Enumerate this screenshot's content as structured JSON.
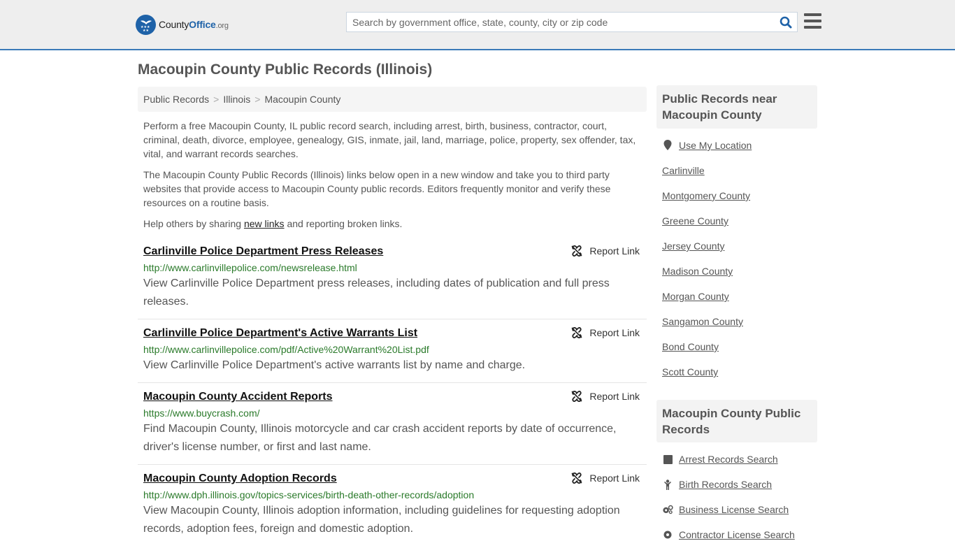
{
  "header": {
    "logo": {
      "name_part1": "County",
      "name_part2": "Office",
      "name_part3": ".org"
    },
    "search": {
      "placeholder": "Search by government office, state, county, city or zip code",
      "value": ""
    },
    "icons": {
      "search": "search-icon",
      "menu": "hamburger-menu-icon"
    }
  },
  "page": {
    "title": "Macoupin County Public Records (Illinois)"
  },
  "breadcrumb": [
    {
      "label": "Public Records"
    },
    {
      "label": "Illinois"
    },
    {
      "label": "Macoupin County"
    }
  ],
  "breadcrumb_separator": ">",
  "intro": {
    "p1": "Perform a free Macoupin County, IL public record search, including arrest, birth, business, contractor, court, criminal, death, divorce, employee, genealogy, GIS, inmate, jail, land, marriage, police, property, sex offender, tax, vital, and warrant records searches.",
    "p2": "The Macoupin County Public Records (Illinois) links below open in a new window and take you to third party websites that provide access to Macoupin County public records. Editors frequently monitor and verify these resources on a routine basis.",
    "p3_before": "Help others by sharing ",
    "p3_link": "new links",
    "p3_after": " and reporting broken links."
  },
  "records": [
    {
      "title": "Carlinville Police Department Press Releases",
      "url": "http://www.carlinvillepolice.com/newsrelease.html",
      "description": "View Carlinville Police Department press releases, including dates of publication and full press releases.",
      "report_label": "Report Link"
    },
    {
      "title": "Carlinville Police Department's Active Warrants List",
      "url": "http://www.carlinvillepolice.com/pdf/Active%20Warrant%20List.pdf",
      "description": "View Carlinville Police Department's active warrants list by name and charge.",
      "report_label": "Report Link"
    },
    {
      "title": "Macoupin County Accident Reports",
      "url": "https://www.buycrash.com/",
      "description": "Find Macoupin County, Illinois motorcycle and car crash accident reports by date of occurrence, driver's license number, or first and last name.",
      "report_label": "Report Link"
    },
    {
      "title": "Macoupin County Adoption Records",
      "url": "http://www.dph.illinois.gov/topics-services/birth-death-other-records/adoption",
      "description": "View Macoupin County, Illinois adoption information, including guidelines for requesting adoption records, adoption fees, foreign and domestic adoption.",
      "report_label": "Report Link"
    }
  ],
  "sidebar": {
    "nearby": {
      "heading": "Public Records near Macoupin County",
      "use_location": {
        "label": "Use My Location",
        "icon": "map-marker-icon"
      },
      "items": [
        {
          "label": "Carlinville"
        },
        {
          "label": "Montgomery County"
        },
        {
          "label": "Greene County"
        },
        {
          "label": "Jersey County"
        },
        {
          "label": "Madison County"
        },
        {
          "label": "Morgan County"
        },
        {
          "label": "Sangamon County"
        },
        {
          "label": "Bond County"
        },
        {
          "label": "Scott County"
        }
      ]
    },
    "county_records": {
      "heading": "Macoupin County Public Records",
      "items": [
        {
          "label": "Arrest Records Search",
          "icon": "square-icon"
        },
        {
          "label": "Birth Records Search",
          "icon": "child-icon"
        },
        {
          "label": "Business License Search",
          "icon": "cogs-icon"
        },
        {
          "label": "Contractor License Search",
          "icon": "cog-icon"
        }
      ]
    }
  },
  "colors": {
    "brand_blue": "#1e62a8",
    "header_bg": "#eeeeee",
    "header_border": "#3a7ab8",
    "url_green": "#2a7a2a",
    "text": "#555555"
  }
}
